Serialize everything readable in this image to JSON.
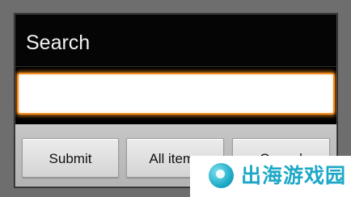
{
  "dialog": {
    "title": "Search",
    "search_input": {
      "value": "",
      "placeholder": ""
    },
    "buttons": {
      "submit": "Submit",
      "all_items": "All items",
      "cancel": "Cancel"
    }
  },
  "watermark": {
    "text": "出海游戏园",
    "icon": "circle-logo-icon"
  },
  "colors": {
    "focus_accent": "#f08a1e",
    "watermark": "#1ea8c7"
  }
}
